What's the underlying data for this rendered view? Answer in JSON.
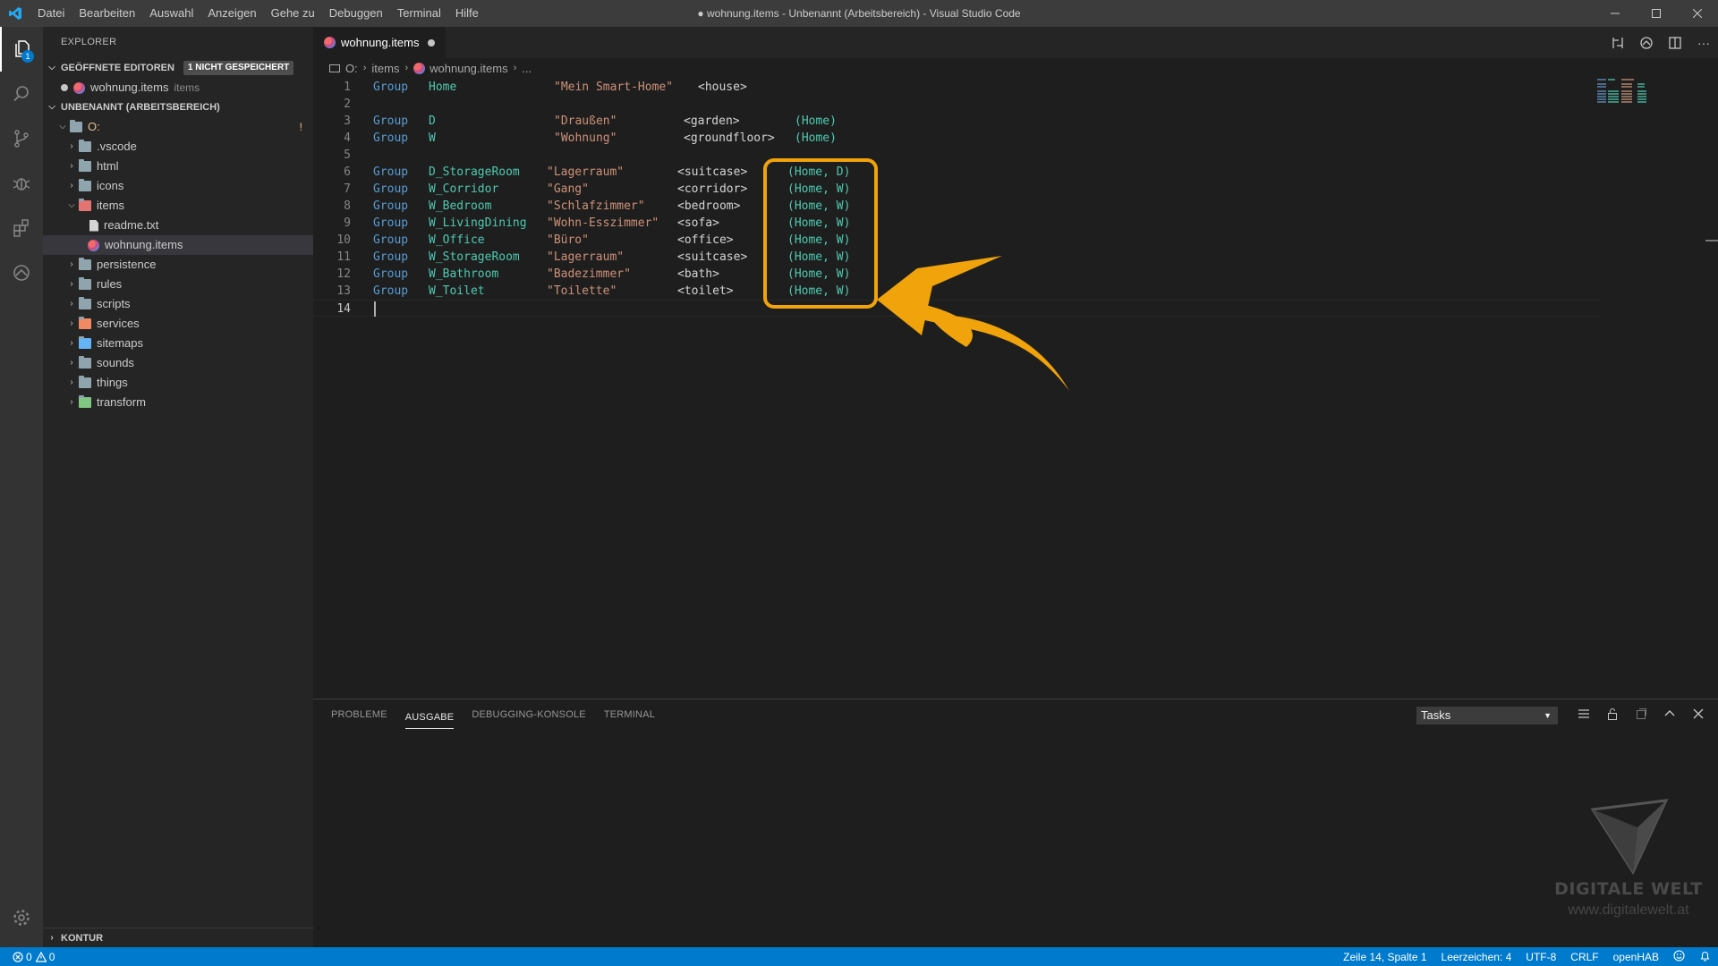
{
  "window": {
    "title": "● wohnung.items - Unbenannt (Arbeitsbereich) - Visual Studio Code",
    "menu": [
      "Datei",
      "Bearbeiten",
      "Auswahl",
      "Anzeigen",
      "Gehe zu",
      "Debuggen",
      "Terminal",
      "Hilfe"
    ]
  },
  "sidebar": {
    "title": "EXPLORER",
    "open_editors": {
      "label": "GEÖFFNETE EDITOREN",
      "badge": "1 NICHT GESPEICHERT",
      "file": "wohnung.items",
      "file_desc": "items"
    },
    "workspace": {
      "label": "UNBENANNT (ARBEITSBEREICH)",
      "root": "O:",
      "root_marker": "!"
    },
    "tree": [
      {
        "label": ".vscode",
        "type": "folder"
      },
      {
        "label": "html",
        "type": "folder"
      },
      {
        "label": "icons",
        "type": "folder"
      },
      {
        "label": "items",
        "type": "folder-open"
      },
      {
        "label": "readme.txt",
        "type": "file"
      },
      {
        "label": "wohnung.items",
        "type": "items-file"
      },
      {
        "label": "persistence",
        "type": "folder"
      },
      {
        "label": "rules",
        "type": "folder"
      },
      {
        "label": "scripts",
        "type": "folder"
      },
      {
        "label": "services",
        "type": "folder"
      },
      {
        "label": "sitemaps",
        "type": "folder"
      },
      {
        "label": "sounds",
        "type": "folder"
      },
      {
        "label": "things",
        "type": "folder"
      },
      {
        "label": "transform",
        "type": "folder"
      }
    ],
    "outline": "KONTUR"
  },
  "tab": {
    "label": "wohnung.items"
  },
  "breadcrumbs": [
    "O:",
    "items",
    "wohnung.items",
    "..."
  ],
  "editor": {
    "lines": [
      {
        "n": "1",
        "kw": "Group",
        "name": "Home",
        "label": "\"Mein Smart-Home\"",
        "tag": "<house>",
        "groups": ""
      },
      {
        "n": "2",
        "kw": "",
        "name": "",
        "label": "",
        "tag": "",
        "groups": ""
      },
      {
        "n": "3",
        "kw": "Group",
        "name": "D",
        "label": "\"Draußen\"",
        "tag": "<garden>",
        "groups": "(Home)"
      },
      {
        "n": "4",
        "kw": "Group",
        "name": "W",
        "label": "\"Wohnung\"",
        "tag": "<groundfloor>",
        "groups": "(Home)"
      },
      {
        "n": "5",
        "kw": "",
        "name": "",
        "label": "",
        "tag": "",
        "groups": ""
      },
      {
        "n": "6",
        "kw": "Group",
        "name": "D_StorageRoom",
        "label": "\"Lagerraum\"",
        "tag": "<suitcase>",
        "groups": "(Home, D)"
      },
      {
        "n": "7",
        "kw": "Group",
        "name": "W_Corridor",
        "label": "\"Gang\"",
        "tag": "<corridor>",
        "groups": "(Home, W)"
      },
      {
        "n": "8",
        "kw": "Group",
        "name": "W_Bedroom",
        "label": "\"Schlafzimmer\"",
        "tag": "<bedroom>",
        "groups": "(Home, W)"
      },
      {
        "n": "9",
        "kw": "Group",
        "name": "W_LivingDining",
        "label": "\"Wohn-Esszimmer\"",
        "tag": "<sofa>",
        "groups": "(Home, W)"
      },
      {
        "n": "10",
        "kw": "Group",
        "name": "W_Office",
        "label": "\"Büro\"",
        "tag": "<office>",
        "groups": "(Home, W)"
      },
      {
        "n": "11",
        "kw": "Group",
        "name": "W_StorageRoom",
        "label": "\"Lagerraum\"",
        "tag": "<suitcase>",
        "groups": "(Home, W)"
      },
      {
        "n": "12",
        "kw": "Group",
        "name": "W_Bathroom",
        "label": "\"Badezimmer\"",
        "tag": "<bath>",
        "groups": "(Home, W)"
      },
      {
        "n": "13",
        "kw": "Group",
        "name": "W_Toilet",
        "label": "\"Toilette\"",
        "tag": "<toilet>",
        "groups": "(Home, W)"
      },
      {
        "n": "14",
        "kw": "",
        "name": "",
        "label": "",
        "tag": "",
        "groups": ""
      }
    ]
  },
  "panel": {
    "tabs": [
      "PROBLEME",
      "AUSGABE",
      "DEBUGGING-KONSOLE",
      "TERMINAL"
    ],
    "active_tab": "AUSGABE",
    "output_channel": "Tasks"
  },
  "watermark": {
    "name": "DIGITALE WELT",
    "url": "www.digitalewelt.at"
  },
  "statusbar": {
    "errors": "0",
    "warnings": "0",
    "position": "Zeile 14, Spalte 1",
    "indent": "Leerzeichen: 4",
    "encoding": "UTF-8",
    "eol": "CRLF",
    "language": "openHAB"
  },
  "colors": {
    "accent": "#007acc",
    "highlight": "#f0a30a",
    "keyword": "#569cd6",
    "identifier": "#4ec9b0",
    "string": "#ce9178"
  }
}
